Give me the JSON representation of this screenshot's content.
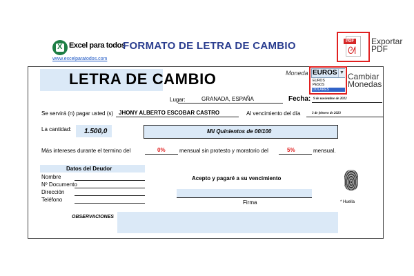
{
  "header": {
    "logo_text": "Excel para todos",
    "logo_link": "www.excelparatodos.com",
    "title": "FORMATO DE LETRA DE CAMBIO",
    "pdf_badge": "PDF",
    "export_label": "Exportar PDF"
  },
  "form": {
    "heading": "LETRA DE CAMBIO",
    "moneda": {
      "label": "Moneda",
      "value": "EUROS",
      "options": [
        "EUROS",
        "PESOS",
        "DOLARES"
      ],
      "highlighted_option": "DOLARES",
      "change_label": "Cambiar Monedas"
    },
    "lugar": {
      "label": "Lugar:",
      "value": "GRANADA, ESPAÑA"
    },
    "fecha": {
      "label": "Fecha:",
      "value": "9 de noviembre de 2022"
    },
    "servira": {
      "label": "Se servirá (n) pagar usted (s)",
      "value": "JHONY ALBERTO ESCOBAR CASTRO"
    },
    "vencimiento": {
      "label": "Al vencimiento del día",
      "value": "3 de febrero de 2023"
    },
    "cantidad": {
      "label": "La cantidad:",
      "value": "1.500,0",
      "words": "Mil Quinientos de  00/100"
    },
    "intereses": {
      "label": "Más intereses durante el termino del",
      "pct_mensual": "0%",
      "middle_label": "mensual sin protesto y moratorio del",
      "pct_moratorio": "5%",
      "end_label": "mensual."
    },
    "deudor": {
      "title": "Datos del Deudor",
      "fields": [
        "Nombre",
        "Nº Documento",
        "Dirección",
        "Teléfono"
      ]
    },
    "acepto": "Acepto y pagaré a su vencimiento",
    "firma": "Firma",
    "huella": "* Huella",
    "observaciones": "OBSERVACIONES"
  },
  "colors": {
    "title_blue": "#2a3d8f",
    "field_fill": "#dbe9f7",
    "highlight_red": "#e02020",
    "logo_green": "#1e7e45"
  }
}
